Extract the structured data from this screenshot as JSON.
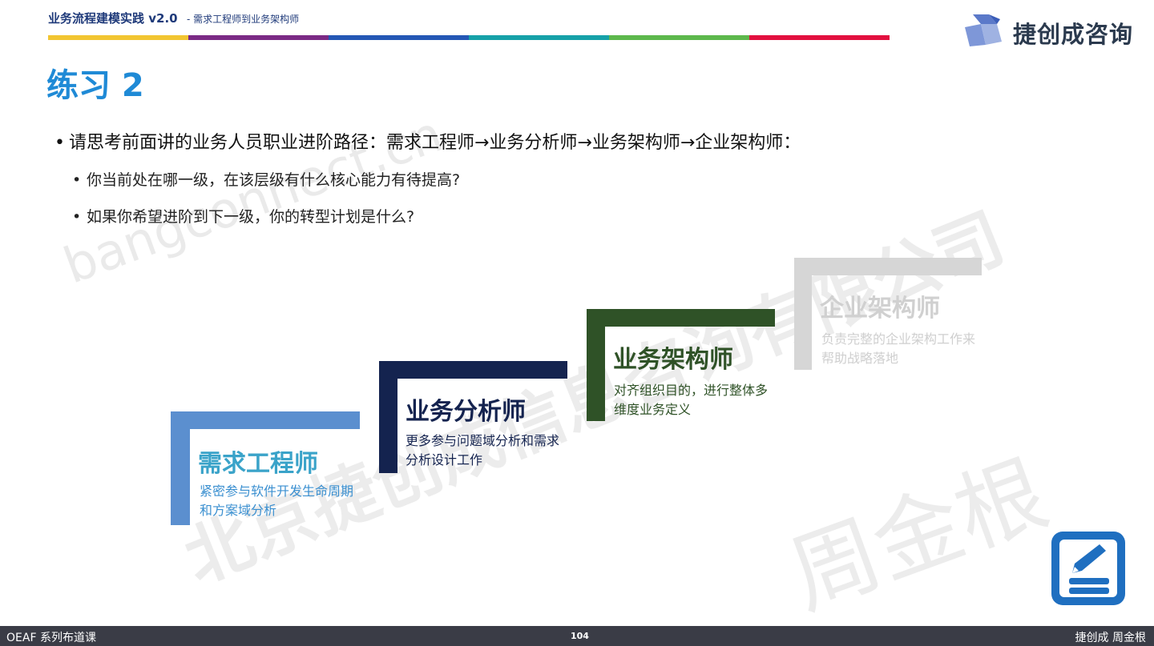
{
  "header": {
    "title": "业务流程建模实践 v2.0",
    "subtitle": "- 需求工程师到业务架构师",
    "bar_colors": [
      "#f2c531",
      "#7b2a85",
      "#2457b5",
      "#16a1a8",
      "#5db84c",
      "#e2103f"
    ]
  },
  "logo": {
    "name": "捷创成咨询"
  },
  "page_title": "练习 2",
  "bullets": {
    "main": "请思考前面讲的业务人员职业进阶路径：需求工程师→业务分析师→业务架构师→企业架构师：",
    "sub": [
      "你当前处在哪一级，在该层级有什么核心能力有待提高?",
      "如果你希望进阶到下一级，你的转型计划是什么?"
    ]
  },
  "steps": [
    {
      "title": "需求工程师",
      "desc": "紧密参与软件开发生命周期和方案域分析",
      "color": "#5b8fcf",
      "title_color": "#3aa3c9",
      "desc_color": "#3a8fd0"
    },
    {
      "title": "业务分析师",
      "desc": "更多参与问题域分析和需求分析设计工作",
      "color": "#14234f",
      "title_color": "#14234f",
      "desc_color": "#14234f"
    },
    {
      "title": "业务架构师",
      "desc": "对齐组织目的，进行整体多维度业务定义",
      "color": "#2f5227",
      "title_color": "#2f5227",
      "desc_color": "#2f5227"
    },
    {
      "title": "企业架构师",
      "desc": "负责完整的企业架构工作来帮助战略落地",
      "color": "#d6d6d6",
      "title_color": "#d0d0d0",
      "desc_color": "#cfcfcf"
    }
  ],
  "watermarks": [
    "bangconnect.cn",
    "北京捷创成信息咨询有限公司",
    "周金根"
  ],
  "footer": {
    "left": "OEAF 系列布道课",
    "page": "104",
    "right": "捷创成 周金根"
  }
}
